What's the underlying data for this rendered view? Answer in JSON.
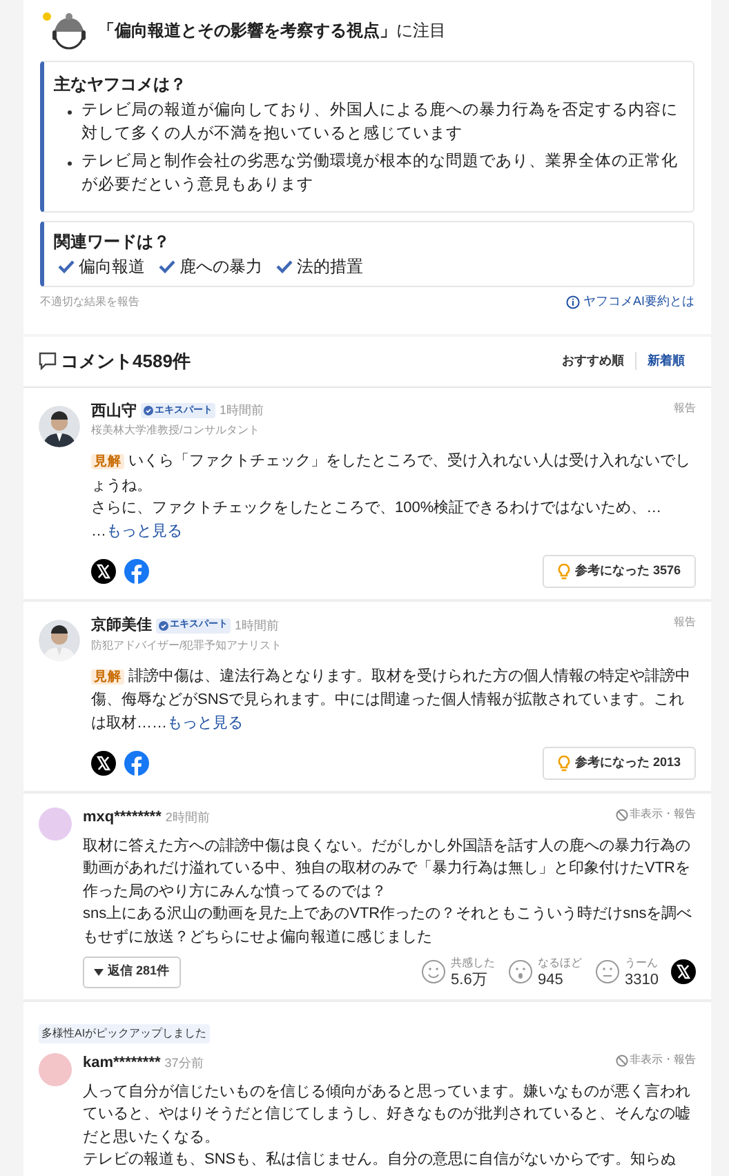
{
  "summary": {
    "heading": "「偏向報道とその影響を考察する視点」",
    "heading_suffix": "に注目",
    "main_title": "主なヤフコメは？",
    "points": [
      "テレビ局の報道が偏向しており、外国人による鹿への暴力行為を否定する内容に対して多くの人が不満を抱いていると感じています",
      "テレビ局と制作会社の劣悪な労働環境が根本的な問題であり、業界全体の正常化が必要だという意見もあります"
    ],
    "words_title": "関連ワードは？",
    "words": [
      "偏向報道",
      "鹿への暴力",
      "法的措置"
    ],
    "report": "不適切な結果を報告",
    "about": "ヤフコメAI要約とは"
  },
  "comments_header": {
    "title": "コメント4589件",
    "sorts": [
      {
        "label": "おすすめ順",
        "selected": false
      },
      {
        "label": "新着順",
        "selected": true
      }
    ]
  },
  "comments": [
    {
      "kind": "expert",
      "name": "西山守",
      "badge": "エキスパート",
      "time": "1時間前",
      "role": "桜美林大学准教授/コンサルタント",
      "report": "報告",
      "tag": "見解",
      "body": [
        "いくら「ファクトチェック」をしたところで、受け入れない人は受け入れないでしょうね。",
        "さらに、ファクトチェックをしたところで、100%検証できるわけではないため、…",
        "…"
      ],
      "more": "もっと見る",
      "helpful": "参考になった",
      "helpful_count": "3576"
    },
    {
      "kind": "expert",
      "name": "京師美佳",
      "badge": "エキスパート",
      "time": "1時間前",
      "role": "防犯アドバイザー/犯罪予知アナリスト",
      "report": "報告",
      "tag": "見解",
      "body": [
        "誹謗中傷は、違法行為となります。取材を受けられた方の個人情報の特定や誹謗中傷、侮辱などがSNSで見られます。中には間違った個人情報が拡散されています。これは取材……"
      ],
      "more": "もっと見る",
      "helpful": "参考になった",
      "helpful_count": "2013"
    },
    {
      "kind": "user",
      "name": "mxq********",
      "time": "2時間前",
      "color": "#e6cdf0",
      "hide_report": "非表示・報告",
      "body": [
        "取材に答えた方への誹謗中傷は良くない。だがしかし外国語を話す人の鹿への暴力行為の動画があれだけ溢れている中、独自の取材のみで「暴力行為は無し」と印象付けたVTRを作った局のやり方にみんな憤ってるのでは？",
        "sns上にある沢山の動画を見た上であのVTR作ったの？それともこういう時だけsnsを調べもせずに放送？どちらにせよ偏向報道に感じました"
      ],
      "replies": "返信 281件",
      "reactions": [
        {
          "label": "共感した",
          "count": "5.6万",
          "kind": "smile"
        },
        {
          "label": "なるほど",
          "count": "945",
          "kind": "wow"
        },
        {
          "label": "うーん",
          "count": "3310",
          "kind": "hmm"
        }
      ]
    },
    {
      "kind": "user",
      "pickup": "多様性AIがピックアップしました",
      "name": "kam********",
      "time": "37分前",
      "color": "#f3c4c8",
      "hide_report": "非表示・報告",
      "body": [
        "人って自分が信じたいものを信じる傾向があると思っています。嫌いなものが悪く言われていると、やはりそうだと信じてしまうし、好きなものが批判されていると、そんなの嘘だと思いたくなる。",
        "テレビの報道も、SNSも、私は信じません。自分の意思に自信がないからです。知らぬ"
      ]
    }
  ]
}
